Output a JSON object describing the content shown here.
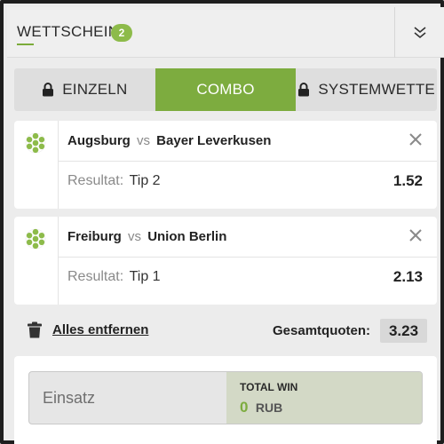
{
  "header": {
    "title": "WETTSCHEIN",
    "badge_count": "2",
    "collapse_icon": "double-chevron-down-icon"
  },
  "tabs": [
    {
      "label": "EINZELN",
      "icon": "lock-icon",
      "active": false
    },
    {
      "label": "COMBO",
      "icon": "",
      "active": true
    },
    {
      "label": "SYSTEMWETTE",
      "icon": "lock-icon",
      "active": false
    }
  ],
  "bets": [
    {
      "home": "Augsburg",
      "vs": "vs",
      "away": "Bayer Leverkusen",
      "result_label": "Resultat:",
      "tip": "Tip 2",
      "odds": "1.52",
      "sport_icon": "football-icon"
    },
    {
      "home": "Freiburg",
      "vs": "vs",
      "away": "Union Berlin",
      "result_label": "Resultat:",
      "tip": "Tip 1",
      "odds": "2.13",
      "sport_icon": "football-icon"
    }
  ],
  "summary": {
    "remove_all_label": "Alles entfernen",
    "total_odds_label": "Gesamtquoten:",
    "total_odds_value": "3.23"
  },
  "stake": {
    "placeholder": "Einsatz",
    "total_win_label": "TOTAL WIN",
    "total_win_amount": "0",
    "currency": "RUB"
  },
  "colors": {
    "accent": "#7dac3f",
    "badge": "#8dbb4a",
    "win_bg": "#d3d9c6"
  }
}
